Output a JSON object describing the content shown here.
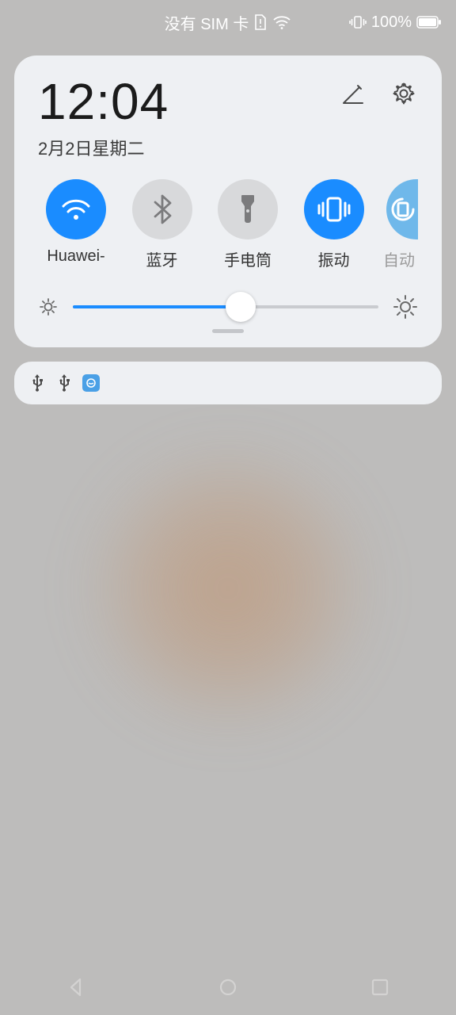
{
  "status": {
    "sim_text": "没有 SIM 卡",
    "battery_text": "100%"
  },
  "panel": {
    "time": "12:04",
    "date": "2月2日星期二"
  },
  "toggles": [
    {
      "id": "wifi",
      "label": "Huawei-",
      "active": true
    },
    {
      "id": "bluetooth",
      "label": "蓝牙",
      "active": false
    },
    {
      "id": "flashlight",
      "label": "手电筒",
      "active": false
    },
    {
      "id": "vibrate",
      "label": "振动",
      "active": true
    },
    {
      "id": "autorotate",
      "label": "自动",
      "active": false,
      "partial": true
    }
  ],
  "brightness": {
    "percent": 55
  },
  "colors": {
    "accent": "#1a8cff"
  }
}
